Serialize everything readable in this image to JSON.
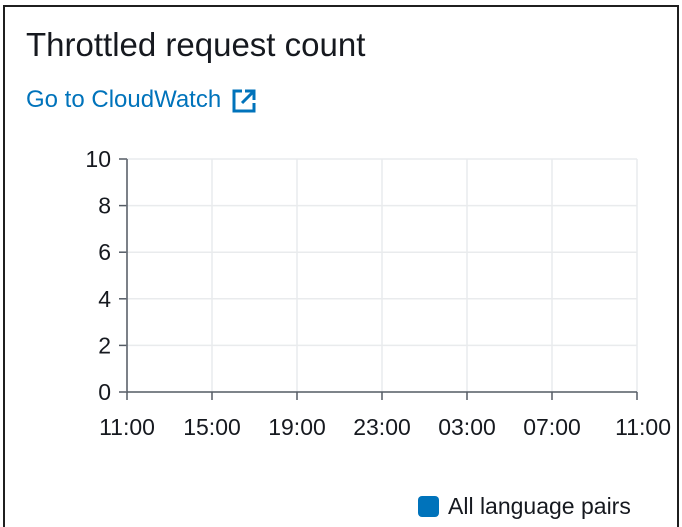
{
  "widget": {
    "title": "Throttled request count",
    "link_label": "Go to CloudWatch",
    "link_icon": "external-link-icon"
  },
  "colors": {
    "link": "#0073bb",
    "series": "#0073bb",
    "grid": "#e9ebed",
    "axis": "#545b64",
    "text": "#16191f"
  },
  "chart_data": {
    "type": "line",
    "title": "",
    "xlabel": "",
    "ylabel": "",
    "y_ticks": [
      "0",
      "2",
      "4",
      "6",
      "8",
      "10"
    ],
    "x_ticks": [
      "11:00",
      "15:00",
      "19:00",
      "23:00",
      "03:00",
      "07:00",
      "11:00"
    ],
    "ylim": [
      0,
      10
    ],
    "grid": true,
    "series": [
      {
        "name": "All language pairs",
        "values": []
      }
    ],
    "legend": "bottom-right"
  }
}
